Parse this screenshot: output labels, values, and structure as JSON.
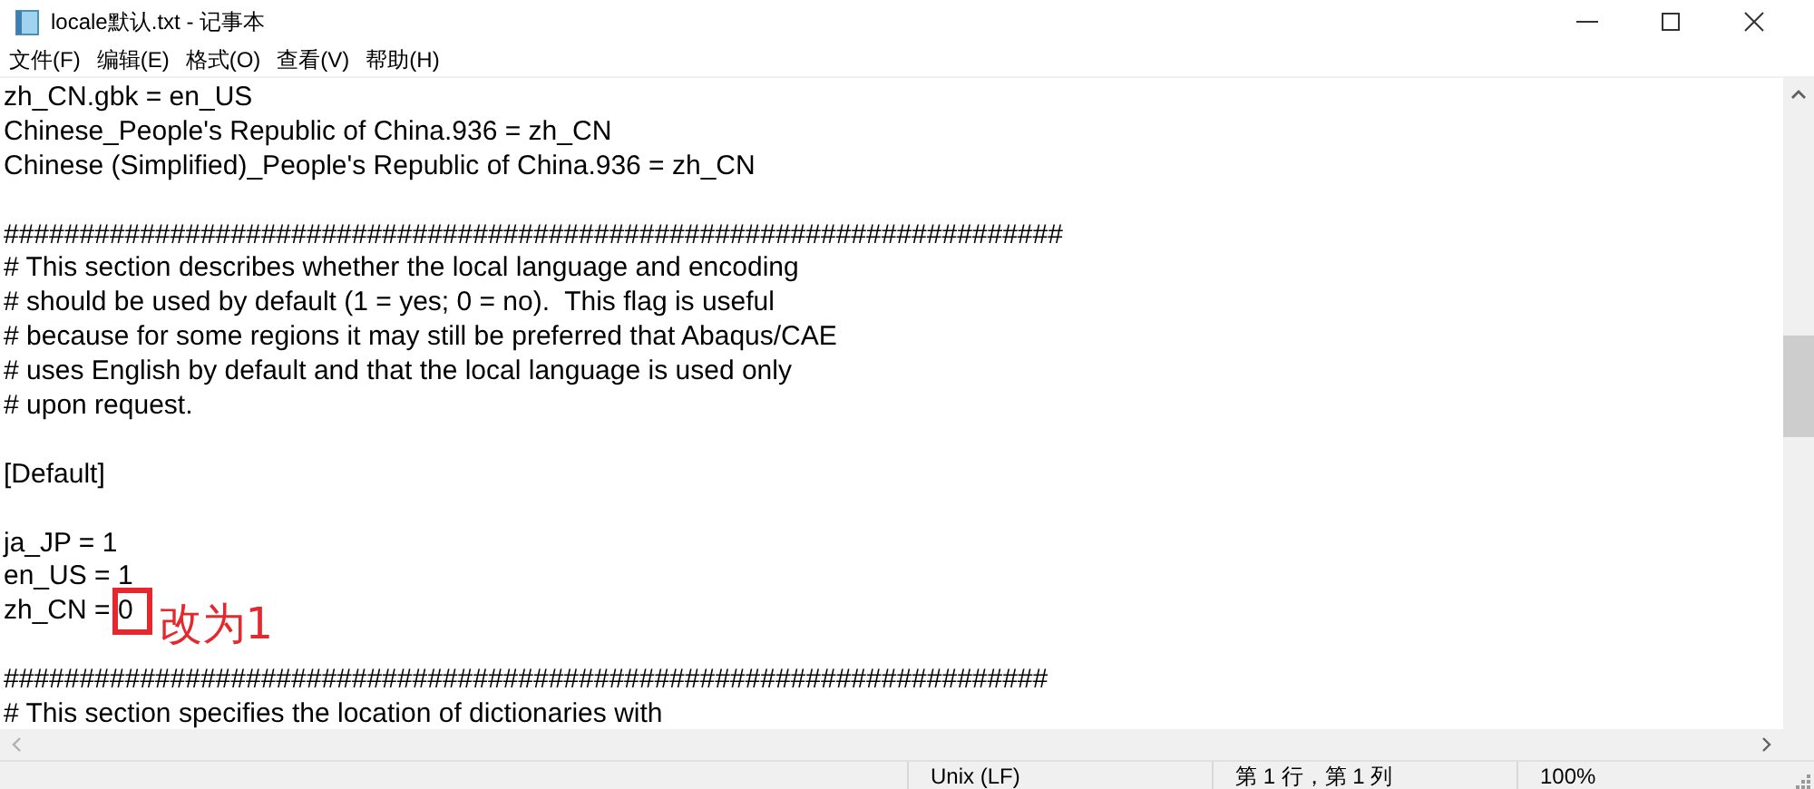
{
  "window": {
    "title": "locale默认.txt - 记事本"
  },
  "menu": [
    "文件(F)",
    "编辑(E)",
    "格式(O)",
    "查看(V)",
    "帮助(H)"
  ],
  "lines": [
    {
      "kind": "text",
      "text": "zh_CN.gbk = en_US"
    },
    {
      "kind": "text",
      "text": "Chinese_People's Republic of China.936 = zh_CN"
    },
    {
      "kind": "text",
      "text": "Chinese (Simplified)_People's Republic of China.936 = zh_CN"
    },
    {
      "kind": "blank"
    },
    {
      "kind": "text",
      "text": "######################################################################"
    },
    {
      "kind": "text",
      "text": "# This section describes whether the local language and encoding"
    },
    {
      "kind": "text",
      "text": "# should be used by default (1 = yes; 0 = no).  This flag is useful"
    },
    {
      "kind": "text",
      "text": "# because for some regions it may still be preferred that Abaqus/CAE"
    },
    {
      "kind": "text",
      "text": "# uses English by default and that the local language is used only"
    },
    {
      "kind": "text",
      "text": "# upon request."
    },
    {
      "kind": "blank"
    },
    {
      "kind": "text",
      "text": "[Default]"
    },
    {
      "kind": "blank"
    },
    {
      "kind": "text",
      "text": "ja_JP = 1"
    },
    {
      "kind": "text",
      "text": "en_US = 1"
    },
    {
      "kind": "marked",
      "text": "zh_CN = ",
      "marked": "0",
      "note": "改为1"
    },
    {
      "kind": "blank"
    },
    {
      "kind": "text",
      "text": "#####################################################################"
    },
    {
      "kind": "text",
      "text": "# This section specifies the location of dictionaries with"
    }
  ],
  "status_bar": [
    "Unix (LF)",
    "第 1 行，第 1 列",
    "100%"
  ]
}
